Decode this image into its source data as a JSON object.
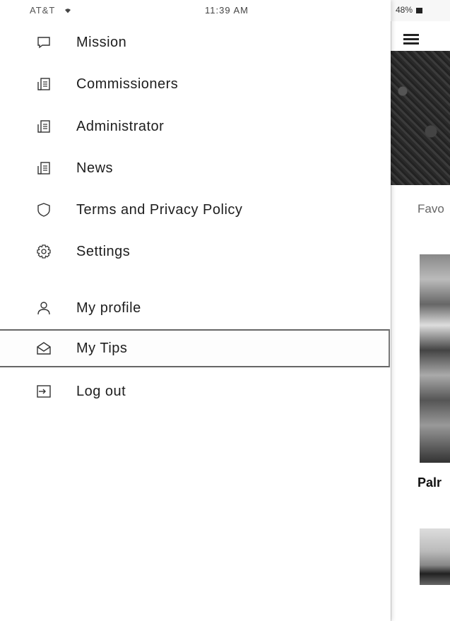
{
  "status_bar": {
    "carrier": "AT&T",
    "time": "11:39 AM",
    "battery": "48%"
  },
  "drawer": {
    "items": [
      {
        "label": "Mission",
        "icon": "chat-bubble-icon"
      },
      {
        "label": "Commissioners",
        "icon": "document-list-icon"
      },
      {
        "label": "Administrator",
        "icon": "document-list-icon"
      },
      {
        "label": "News",
        "icon": "document-list-icon"
      },
      {
        "label": "Terms and Privacy Policy",
        "icon": "shield-icon"
      },
      {
        "label": "Settings",
        "icon": "gear-icon"
      },
      {
        "label": "My profile",
        "icon": "person-icon"
      },
      {
        "label": "My Tips",
        "icon": "envelope-open-icon",
        "selected": true
      },
      {
        "label": "Log out",
        "icon": "log-out-icon"
      }
    ]
  },
  "behind": {
    "section_label": "Favo",
    "card_title": "Palr"
  }
}
